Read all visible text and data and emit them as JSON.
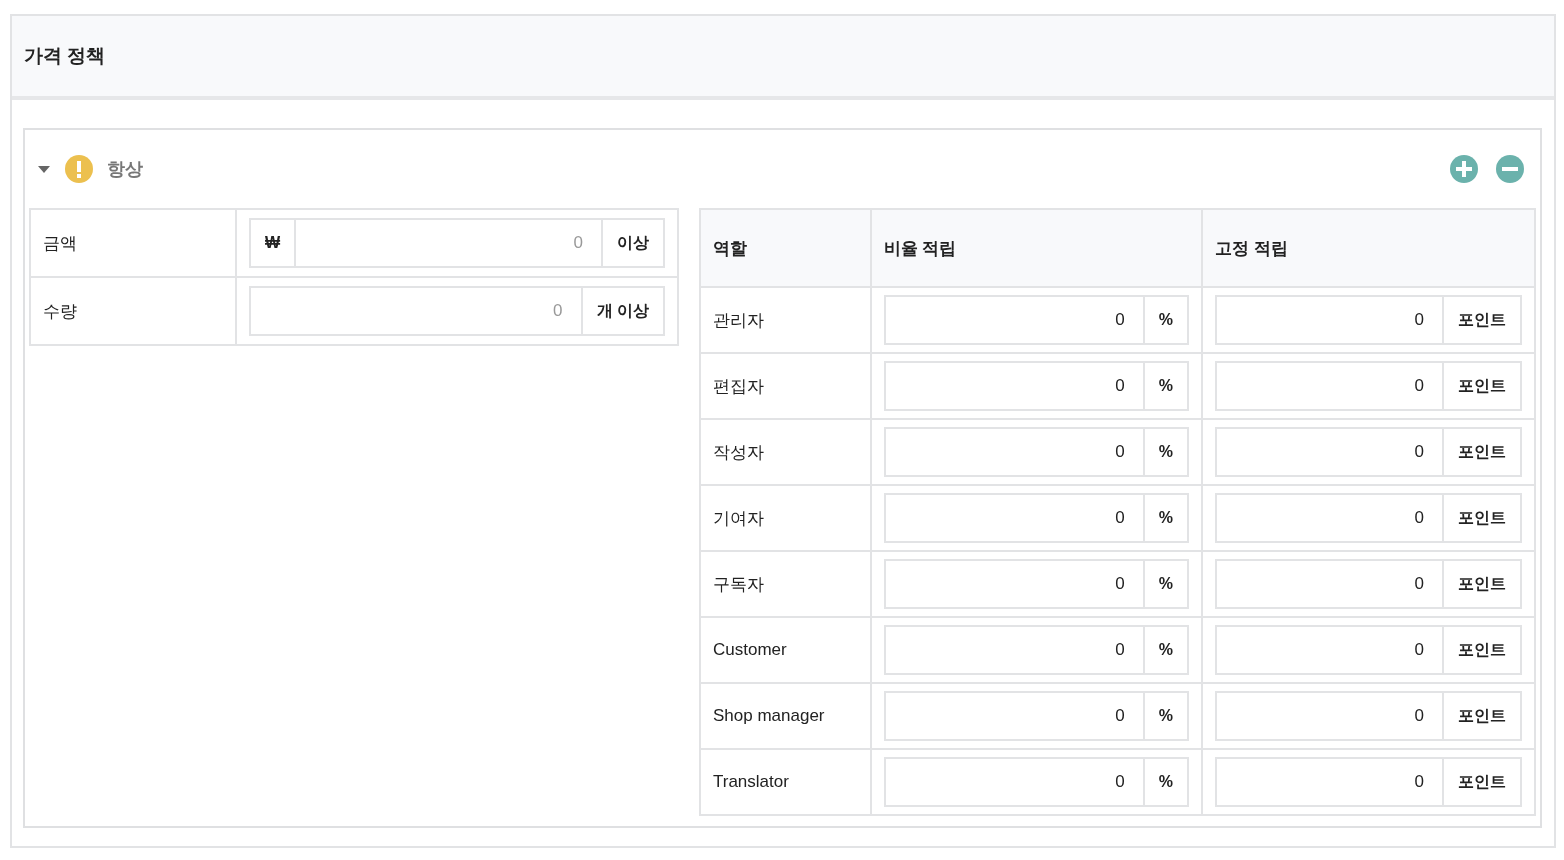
{
  "panel": {
    "title": "가격 정책"
  },
  "rule": {
    "expanded": true,
    "title": "항상"
  },
  "conditions": [
    {
      "label": "금액",
      "prefix": "₩",
      "placeholder": "0",
      "suffix": "이상"
    },
    {
      "label": "수량",
      "placeholder": "0",
      "suffix": "개 이상"
    }
  ],
  "table": {
    "columns": [
      "역할",
      "비율 적립",
      "고정 적립"
    ],
    "rows": [
      {
        "role": "관리자",
        "rate": "0",
        "rate_unit": "%",
        "fixed": "0",
        "fixed_unit": "포인트"
      },
      {
        "role": "편집자",
        "rate": "0",
        "rate_unit": "%",
        "fixed": "0",
        "fixed_unit": "포인트"
      },
      {
        "role": "작성자",
        "rate": "0",
        "rate_unit": "%",
        "fixed": "0",
        "fixed_unit": "포인트"
      },
      {
        "role": "기여자",
        "rate": "0",
        "rate_unit": "%",
        "fixed": "0",
        "fixed_unit": "포인트"
      },
      {
        "role": "구독자",
        "rate": "0",
        "rate_unit": "%",
        "fixed": "0",
        "fixed_unit": "포인트"
      },
      {
        "role": "Customer",
        "rate": "0",
        "rate_unit": "%",
        "fixed": "0",
        "fixed_unit": "포인트"
      },
      {
        "role": "Shop manager",
        "rate": "0",
        "rate_unit": "%",
        "fixed": "0",
        "fixed_unit": "포인트"
      },
      {
        "role": "Translator",
        "rate": "0",
        "rate_unit": "%",
        "fixed": "0",
        "fixed_unit": "포인트"
      }
    ]
  }
}
